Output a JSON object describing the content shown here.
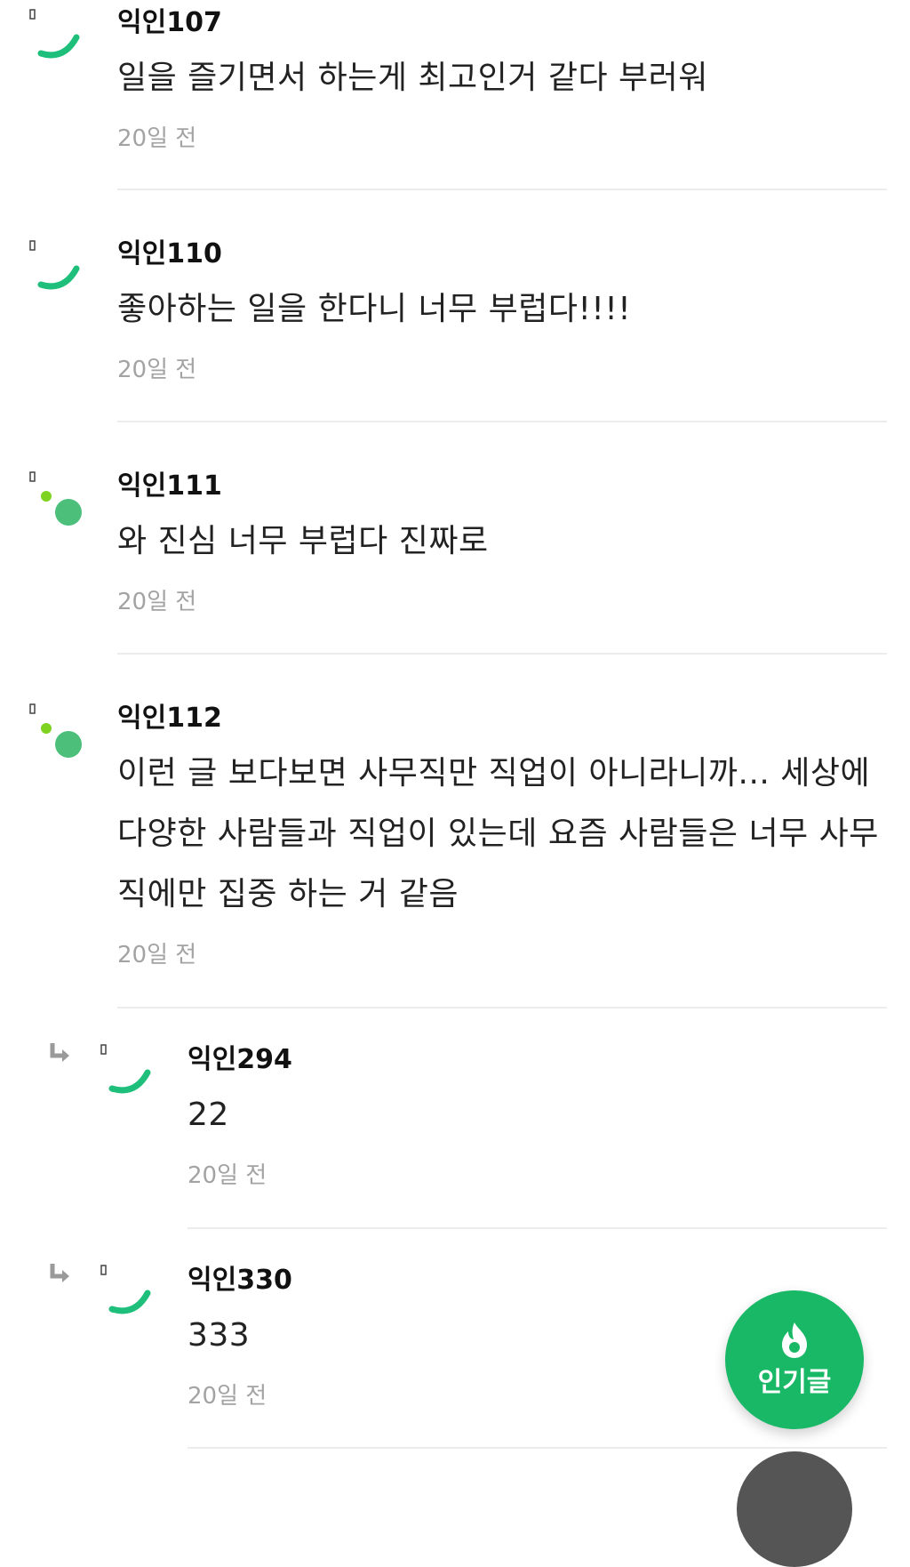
{
  "comments": [
    {
      "nickname": "익인107",
      "text": "일을 즐기면서 하는게 최고인거 같다 부러워",
      "time": "20일 전",
      "avatar": "arc-avatar-icon",
      "reply": false
    },
    {
      "nickname": "익인110",
      "text": "좋아하는 일을 한다니 너무 부럽다!!!!",
      "time": "20일 전",
      "avatar": "arc-avatar-icon",
      "reply": false
    },
    {
      "nickname": "익인111",
      "text": "와 진심 너무 부럽다 진짜로",
      "time": "20일 전",
      "avatar": "dots-avatar-icon",
      "reply": false
    },
    {
      "nickname": "익인112",
      "text": "이런 글 보다보면 사무직만 직업이 아니라니까... 세상에 다양한 사람들과 직업이 있는데 요즘 사람들은 너무 사무직에만 집중 하는 거 같음",
      "time": "20일 전",
      "avatar": "dots-avatar-icon",
      "reply": false
    },
    {
      "nickname": "익인294",
      "text": "22",
      "time": "20일 전",
      "avatar": "arc-avatar-icon",
      "reply": true
    },
    {
      "nickname": "익인330",
      "text": "333",
      "time": "20일 전",
      "avatar": "arc-avatar-icon",
      "reply": true
    }
  ],
  "fab": {
    "label": "인기글",
    "icon": "flame-icon"
  },
  "colors": {
    "brand_green": "#19b866",
    "avatar_arc": "#1dbf7a",
    "avatar_dot_large": "#4cc07a",
    "avatar_dot_small": "#7ed321",
    "time_gray": "#a3a3a3",
    "divider": "#ececec"
  }
}
